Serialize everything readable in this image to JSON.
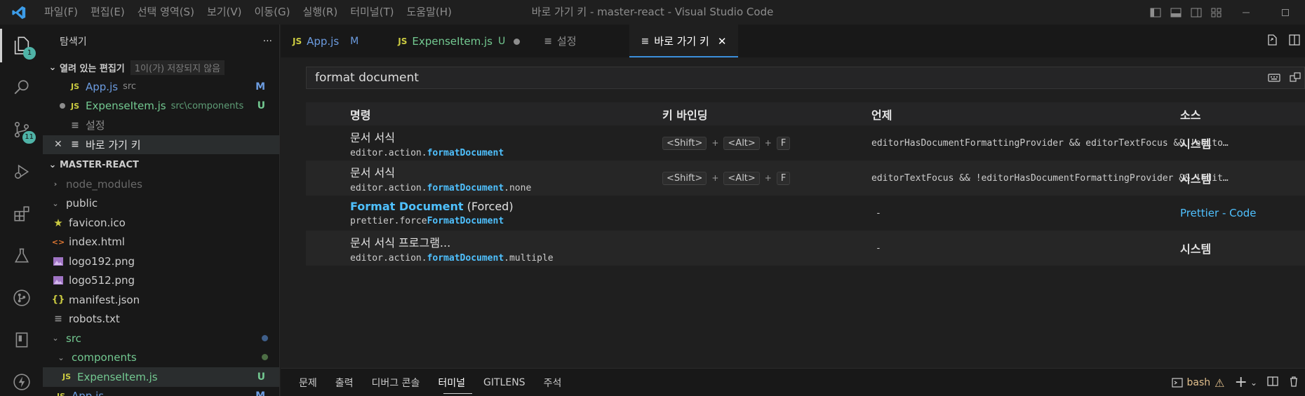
{
  "titlebar": {
    "menu": [
      "파일(F)",
      "편집(E)",
      "선택 영역(S)",
      "보기(V)",
      "이동(G)",
      "실행(R)",
      "터미널(T)",
      "도움말(H)"
    ],
    "title": "바로 가기 키 - master-react - Visual Studio Code"
  },
  "activity": {
    "explorer_badge": "1",
    "scm_badge": "11"
  },
  "sidebar": {
    "title": "탐색기",
    "more": "···",
    "open_editors": {
      "label": "열려 있는 편집기",
      "hint": "1이(가) 저장되지 않음",
      "items": [
        {
          "icon": "JS",
          "name": "App.js",
          "desc": "src",
          "status": "M"
        },
        {
          "icon": "JS",
          "name": "ExpenseItem.js",
          "desc": "src\\components",
          "status": "U"
        },
        {
          "icon": "≡",
          "name": "설정",
          "desc": "",
          "status": ""
        },
        {
          "icon": "≡",
          "name": "바로 가기 키",
          "desc": "",
          "status": ""
        }
      ]
    },
    "project": {
      "label": "MASTER-REACT",
      "items": [
        {
          "name": "node_modules"
        },
        {
          "name": "public"
        },
        {
          "name": "favicon.ico"
        },
        {
          "name": "index.html"
        },
        {
          "name": "logo192.png"
        },
        {
          "name": "logo512.png"
        },
        {
          "name": "manifest.json"
        },
        {
          "name": "robots.txt"
        },
        {
          "name": "src"
        },
        {
          "name": "components"
        },
        {
          "name": "ExpenseItem.js",
          "status": "U"
        },
        {
          "name": "App.js",
          "status": "M"
        }
      ]
    }
  },
  "tabs": [
    {
      "icon": "JS",
      "label": "App.js",
      "status": "M"
    },
    {
      "icon": "JS",
      "label": "ExpenseItem.js",
      "status": "U"
    },
    {
      "icon": "≡",
      "label": "설정"
    },
    {
      "icon": "≡",
      "label": "바로 가기 키",
      "close": "✕"
    }
  ],
  "keybindings": {
    "search_value": "format document",
    "headers": {
      "command": "명령",
      "keybinding": "키 바인딩",
      "when": "언제",
      "source": "소스"
    },
    "keys": {
      "shift": "<Shift>",
      "alt": "<Alt>",
      "f": "F",
      "plus": "+"
    },
    "rows": [
      {
        "title": "문서 서식",
        "id_prefix": "editor.action.",
        "id_match": "formatDocument",
        "id_suffix": "",
        "when": "editorHasDocumentFormattingProvider && editorTextFocus && !editorReadonly",
        "source": "시스템"
      },
      {
        "title": "문서 서식",
        "id_prefix": "editor.action.",
        "id_match": "formatDocument",
        "id_suffix": ".none",
        "when": "editorTextFocus && !editorHasDocumentFormattingProvider && !editorReadonly",
        "source": "시스템"
      },
      {
        "title_match": "Format Document",
        "title_rest": " (Forced)",
        "id_prefix": "prettier.force",
        "id_match": "FormatDocument",
        "id_suffix": "",
        "when": "-",
        "source": "Prettier - Code"
      },
      {
        "title": "문서 서식 프로그램...",
        "id_prefix": "editor.action.",
        "id_match": "formatDocument",
        "id_suffix": ".multiple",
        "when": "-",
        "source": "시스템"
      }
    ]
  },
  "panel": {
    "tabs": [
      "문제",
      "출력",
      "디버그 콘솔",
      "터미널",
      "GITLENS",
      "주석"
    ],
    "terminal_name": "bash"
  },
  "colors": {
    "accent": "#3b8edb",
    "js_yellow": "#cbcb41",
    "modified_blue": "#6c9ce0",
    "untracked_green": "#73c991",
    "match_blue": "#4fc1ff"
  }
}
